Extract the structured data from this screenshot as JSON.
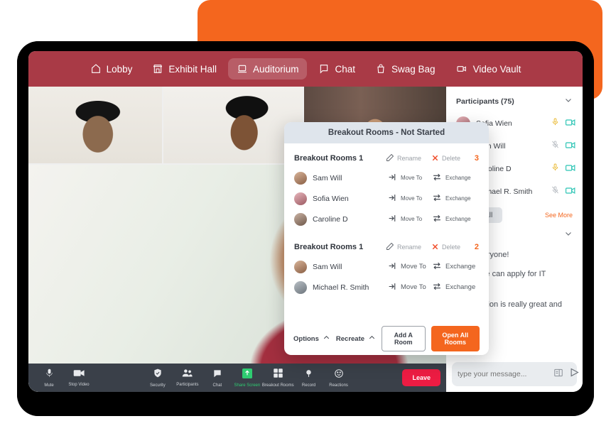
{
  "nav": {
    "items": [
      {
        "label": "Lobby",
        "icon": "home-icon",
        "active": false
      },
      {
        "label": "Exhibit Hall",
        "icon": "store-icon",
        "active": false
      },
      {
        "label": "Auditorium",
        "icon": "presentation-icon",
        "active": true
      },
      {
        "label": "Chat",
        "icon": "chat-bubble-icon",
        "active": false
      },
      {
        "label": "Swag Bag",
        "icon": "bag-icon",
        "active": false
      },
      {
        "label": "Video Vault",
        "icon": "video-camera-icon",
        "active": false
      }
    ]
  },
  "participants_panel": {
    "title": "Participants (75)",
    "rows": [
      {
        "name": "Sofia Wien",
        "mic": "unmuted",
        "video": "on"
      },
      {
        "name": "Sam Will",
        "mic": "muted",
        "video": "on"
      },
      {
        "name": "Caroline D",
        "mic": "unmuted",
        "video": "on"
      },
      {
        "name": "Michael R. Smith",
        "mic": "muted",
        "video": "on"
      }
    ],
    "mute_all_label": "Mute All",
    "see_more_label": "See More"
  },
  "chat": {
    "messages": [
      "Hello everyone!",
      "Where we can apply for IT courses?",
      "This session is really great and helpful."
    ],
    "input_placeholder": "type your message...",
    "attach_icon": "attachment-icon",
    "send_icon": "send-icon"
  },
  "toolbar": {
    "items": [
      {
        "label": "Mute",
        "icon": "microphone-icon",
        "state": "normal"
      },
      {
        "label": "Stop Video",
        "icon": "video-camera-icon",
        "state": "normal"
      },
      {
        "label": "Security",
        "icon": "shield-check-icon",
        "state": "normal"
      },
      {
        "label": "Participants",
        "icon": "people-icon",
        "state": "normal"
      },
      {
        "label": "Chat",
        "icon": "chat-bubble-icon",
        "state": "normal"
      },
      {
        "label": "Share Screen",
        "icon": "share-screen-icon",
        "state": "active"
      },
      {
        "label": "Breakout Rooms",
        "icon": "grid-squares-icon",
        "state": "normal"
      },
      {
        "label": "Record",
        "icon": "record-circle-icon",
        "state": "normal"
      },
      {
        "label": "Reactions",
        "icon": "smiley-icon",
        "state": "normal"
      }
    ],
    "leave_label": "Leave"
  },
  "modal": {
    "title": "Breakout Rooms - Not Started",
    "rename_label": "Rename",
    "delete_label": "Delete",
    "move_to_label": "Move To",
    "exchange_label": "Exchange",
    "rooms": [
      {
        "name": "Breakout Rooms 1",
        "count": "3",
        "members": [
          {
            "name": "Sam Will"
          },
          {
            "name": "Sofia Wien"
          },
          {
            "name": "Caroline D"
          }
        ]
      },
      {
        "name": "Breakout Rooms 1",
        "count": "2",
        "members": [
          {
            "name": "Sam Will"
          },
          {
            "name": "Michael R. Smith"
          }
        ]
      }
    ],
    "footer": {
      "options_label": "Options",
      "recreate_label": "Recreate",
      "add_room_label": "Add A Room",
      "open_all_label": "Open All Rooms"
    }
  },
  "colors": {
    "nav_bar": "#A93A46",
    "accent_orange": "#F4661E",
    "leave_red": "#ED1C43",
    "toolbar_dark": "#3A4049",
    "share_green": "#2ECC71",
    "modal_header": "#DFE5EC",
    "mic_active": "#E8B422",
    "video_on": "#2BC4B4"
  }
}
